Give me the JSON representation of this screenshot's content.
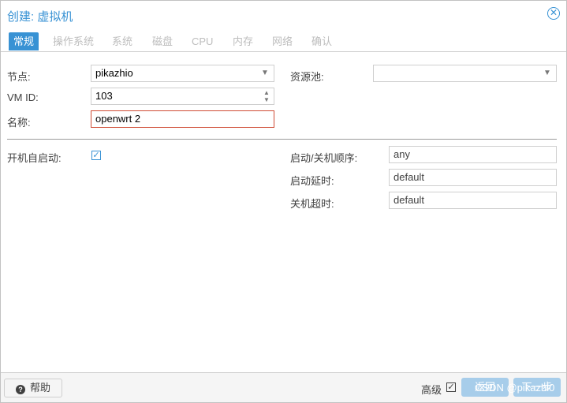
{
  "window": {
    "title": "创建: 虚拟机",
    "close_icon": "close-icon"
  },
  "tabs": [
    {
      "label": "常规",
      "active": true
    },
    {
      "label": "操作系统"
    },
    {
      "label": "系统"
    },
    {
      "label": "磁盘"
    },
    {
      "label": "CPU"
    },
    {
      "label": "内存"
    },
    {
      "label": "网络"
    },
    {
      "label": "确认"
    }
  ],
  "form": {
    "node_label": "节点:",
    "node_value": "pikazhio",
    "vmid_label": "VM ID:",
    "vmid_value": "103",
    "name_label": "名称:",
    "name_value": "openwrt 2",
    "pool_label": "资源池:",
    "pool_value": "",
    "onboot_label": "开机自启动:",
    "onboot_checked": true,
    "order_label": "启动/关机顺序:",
    "order_value": "any",
    "delay_label": "启动延时:",
    "delay_value": "default",
    "timeout_label": "关机超时:",
    "timeout_value": "default"
  },
  "footer": {
    "help_label": "帮助",
    "advanced_label": "高级",
    "advanced_checked": true,
    "back_label": "返回",
    "next_label": "下一步",
    "watermark": "CSDN @pikazhi0"
  },
  "colors": {
    "accent": "#3892d4",
    "error_border": "#cf4c35",
    "disabled_button": "#a7cdea"
  }
}
